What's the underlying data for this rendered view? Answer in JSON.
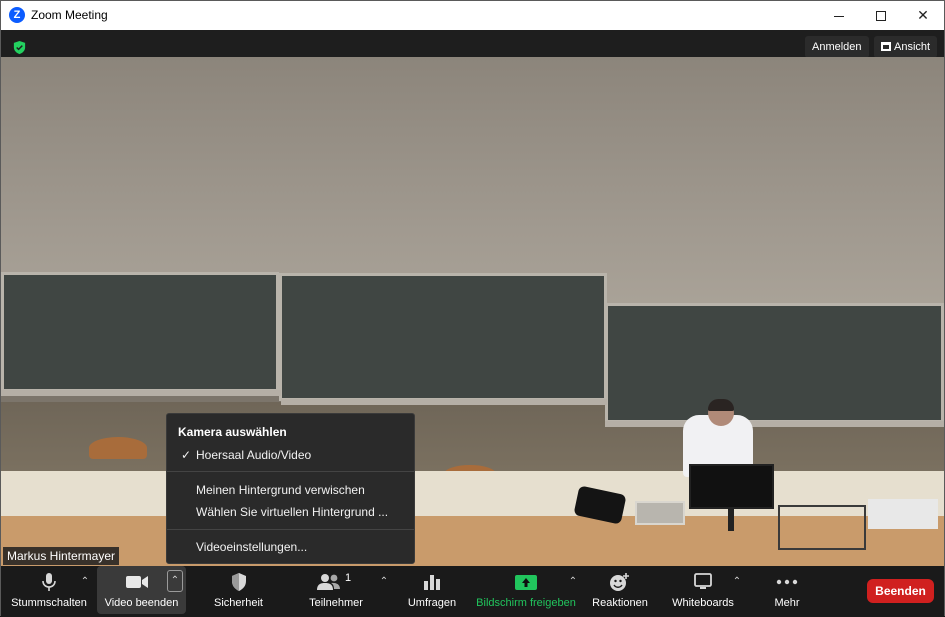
{
  "window": {
    "title": "Zoom Meeting",
    "app_icon_letter": "Z"
  },
  "top_bar": {
    "sign_in": "Anmelden",
    "view": "Ansicht"
  },
  "video": {
    "participant_name": "Markus Hintermayer"
  },
  "camera_menu": {
    "header": "Kamera auswählen",
    "items": [
      {
        "label": "Hoersaal Audio/Video",
        "checked": true
      },
      {
        "label": "Meinen Hintergrund verwischen",
        "checked": false
      },
      {
        "label": "Wählen Sie virtuellen Hintergrund ...",
        "checked": false
      },
      {
        "label": "Videoeinstellungen...",
        "checked": false
      }
    ]
  },
  "toolbar": {
    "mute": "Stummschalten",
    "video": "Video beenden",
    "security": "Sicherheit",
    "participants": "Teilnehmer",
    "participants_count": "1",
    "polls": "Umfragen",
    "share": "Bildschirm freigeben",
    "reactions": "Reaktionen",
    "whiteboards": "Whiteboards",
    "more": "Mehr",
    "end": "Beenden"
  },
  "colors": {
    "share_green": "#21c55d",
    "end_red": "#d0201f",
    "zoom_blue": "#0b5cff"
  }
}
